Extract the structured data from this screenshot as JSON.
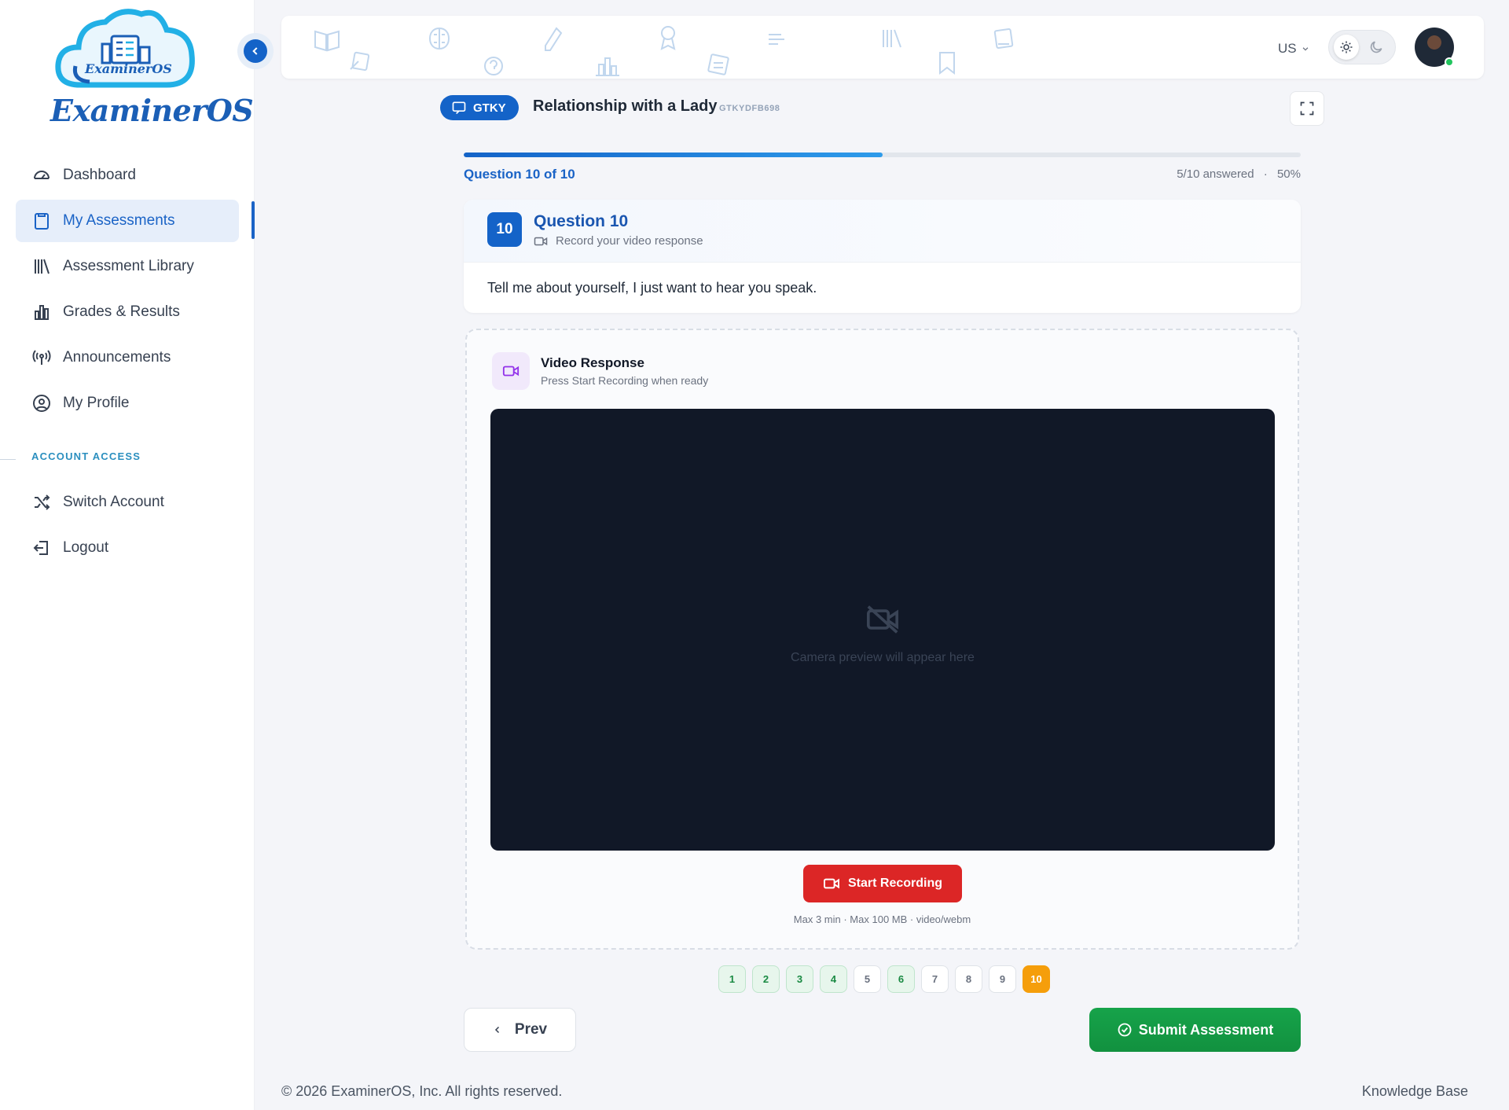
{
  "app": {
    "name": "ExaminerOS",
    "logo_badge_text": "ExaminerOS"
  },
  "sidebar": {
    "items": [
      {
        "label": "Dashboard",
        "icon": "gauge-icon"
      },
      {
        "label": "My Assessments",
        "icon": "clipboard-icon",
        "active": true
      },
      {
        "label": "Assessment Library",
        "icon": "library-icon"
      },
      {
        "label": "Grades & Results",
        "icon": "bar-chart-icon"
      },
      {
        "label": "Announcements",
        "icon": "broadcast-icon"
      },
      {
        "label": "My Profile",
        "icon": "user-circle-icon"
      }
    ],
    "section_label": "ACCOUNT ACCESS",
    "account_items": [
      {
        "label": "Switch Account",
        "icon": "shuffle-icon"
      },
      {
        "label": "Logout",
        "icon": "logout-icon"
      }
    ]
  },
  "header": {
    "language": "US",
    "theme": "light"
  },
  "assessment": {
    "tag": "GTKY",
    "title": "Relationship with a Lady",
    "code": "GTKYDFB698",
    "question_counter": "Question 10 of 10",
    "answered": "5/10 answered",
    "percent_label": "50%",
    "progress_fraction": 0.5
  },
  "question": {
    "number": "10",
    "title": "Question 10",
    "subtitle": "Record your video response",
    "text": "Tell me about yourself, I just want to hear you speak."
  },
  "video": {
    "title": "Video Response",
    "subtitle": "Press Start Recording when ready",
    "placeholder": "Camera preview will appear here",
    "record_label": "Start Recording",
    "limits": "Max 3 min · Max 100 MB · video/webm"
  },
  "pagination": {
    "pages": [
      {
        "label": "1",
        "state": "done"
      },
      {
        "label": "2",
        "state": "done"
      },
      {
        "label": "3",
        "state": "done"
      },
      {
        "label": "4",
        "state": "done"
      },
      {
        "label": "5",
        "state": "todo"
      },
      {
        "label": "6",
        "state": "done"
      },
      {
        "label": "7",
        "state": "todo"
      },
      {
        "label": "8",
        "state": "todo"
      },
      {
        "label": "9",
        "state": "todo"
      },
      {
        "label": "10",
        "state": "current"
      }
    ]
  },
  "actions": {
    "prev_label": "Prev",
    "submit_label": "Submit Assessment"
  },
  "footer": {
    "copyright": "© 2026 ExaminerOS, Inc. All rights reserved.",
    "knowledge_base": "Knowledge Base"
  },
  "colors": {
    "primary": "#1463c8",
    "success": "#16a34a",
    "danger": "#dc2626",
    "current_page": "#f59e0b"
  }
}
